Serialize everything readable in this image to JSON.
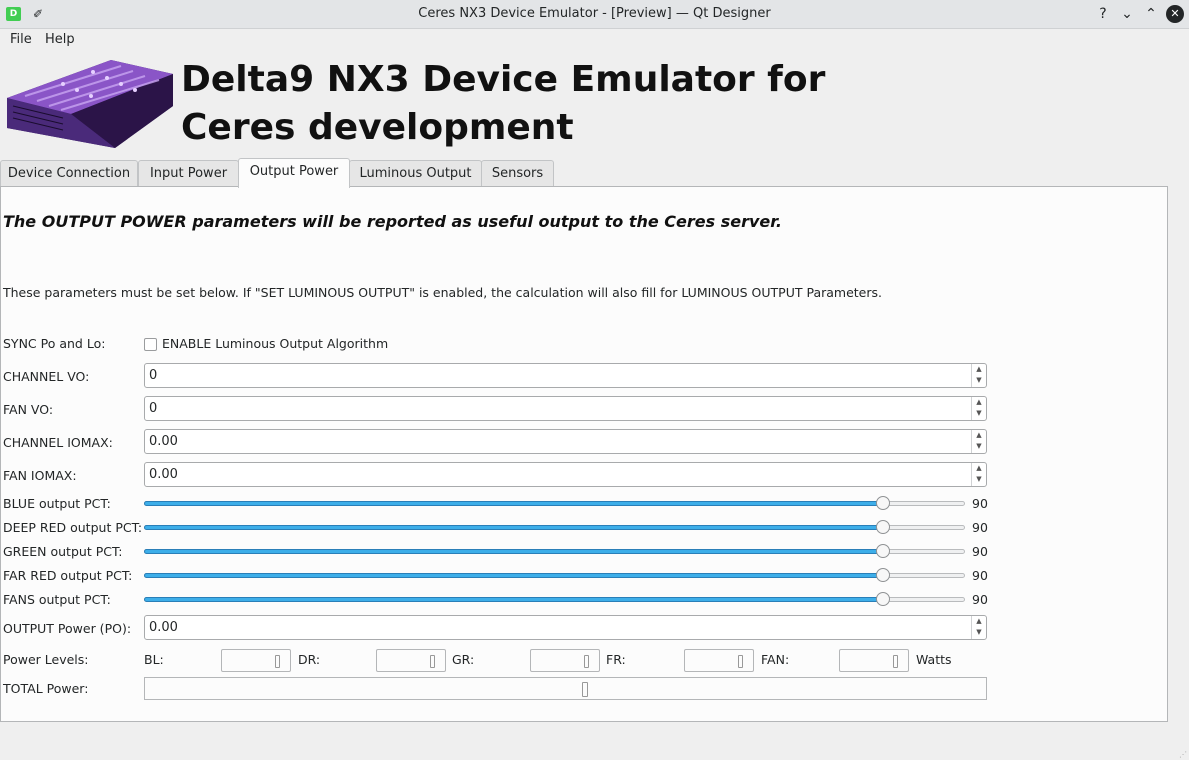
{
  "window": {
    "title": "Ceres NX3 Device Emulator - [Preview] — Qt Designer",
    "app_icon": "D",
    "buttons": [
      "?",
      "⌄",
      "⌃",
      "✕"
    ]
  },
  "menu": [
    "File",
    "Help"
  ],
  "header": {
    "headline": "Delta9 NX3 Device Emulator for Ceres development"
  },
  "tabs": [
    "Device Connection",
    "Input Power",
    "Output Power",
    "Luminous Output",
    "Sensors"
  ],
  "active_tab": "Output Power",
  "page": {
    "heading": "The OUTPUT POWER parameters will be reported as useful output to the Ceres server.",
    "description": "These parameters must be set below. If \"SET LUMINOUS OUTPUT\" is enabled, the calculation will also fill for LUMINOUS OUTPUT Parameters.",
    "sync": {
      "label": "SYNC Po and Lo:",
      "checkbox_label": "ENABLE Luminous Output Algorithm",
      "checked": false
    },
    "spinboxes": [
      {
        "label": "CHANNEL VO:",
        "value": "0"
      },
      {
        "label": "FAN VO:",
        "value": "0"
      },
      {
        "label": "CHANNEL IOMAX:",
        "value": "0.00"
      },
      {
        "label": "FAN IOMAX:",
        "value": "0.00"
      }
    ],
    "sliders": [
      {
        "label": "BLUE output PCT:",
        "value": "90"
      },
      {
        "label": "DEEP RED output PCT:",
        "value": "90"
      },
      {
        "label": "GREEN output PCT:",
        "value": "90"
      },
      {
        "label": "FAR RED output PCT:",
        "value": "90"
      },
      {
        "label": "FANS output PCT:",
        "value": "90"
      }
    ],
    "output_power": {
      "label": "OUTPUT Power (PO):",
      "value": "0.00"
    },
    "power_levels": {
      "label": "Power Levels:",
      "items": [
        "BL:",
        "DR:",
        "GR:",
        "FR:",
        "FAN:"
      ],
      "unit": "Watts"
    },
    "total_power": {
      "label": "TOTAL Power:"
    }
  },
  "colors": {
    "slider_fill": "#3daee9",
    "panel": "#fcfcfc"
  }
}
